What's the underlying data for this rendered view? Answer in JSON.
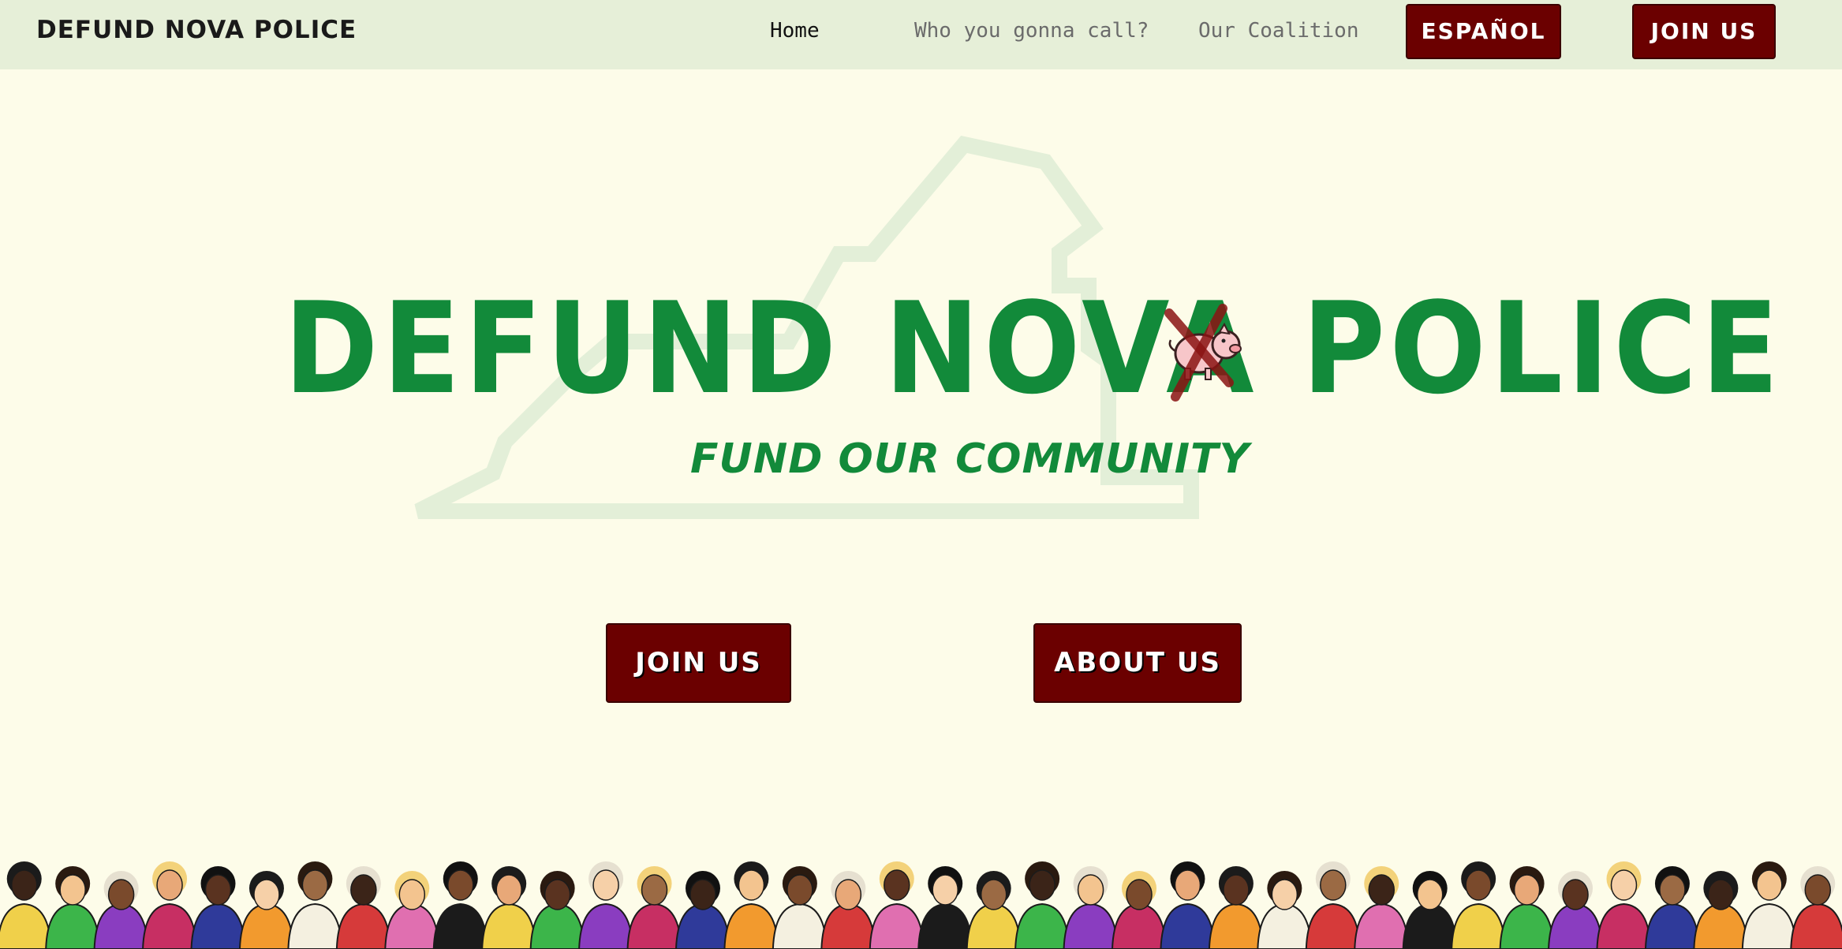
{
  "nav": {
    "brand": "DEFUND NOVA POLICE",
    "links": [
      {
        "label": "Home",
        "active": true
      },
      {
        "label": "Who you gonna call?",
        "active": false
      },
      {
        "label": "Our Coalition",
        "active": false
      }
    ],
    "espanol_label": "ESPAÑOL",
    "join_label": "JOIN US"
  },
  "hero": {
    "title": "DEFUND NOVA POLICE",
    "subtitle": "FUND OUR COMMUNITY",
    "join_label": "JOIN US",
    "about_label": "ABOUT US"
  },
  "colors": {
    "background": "#fdfce9",
    "nav_background": "#e6efd8",
    "accent_green": "#128a3a",
    "button_red": "#6b0000",
    "outline_green": "#e3efd8"
  },
  "crowd": {
    "palette": [
      "#f0d04a",
      "#d63a3a",
      "#2f3a9a",
      "#3cb54a",
      "#e06fb0",
      "#f29a2e",
      "#8a3dc0",
      "#1b1b1b",
      "#f4f0e0",
      "#c72f63"
    ]
  }
}
